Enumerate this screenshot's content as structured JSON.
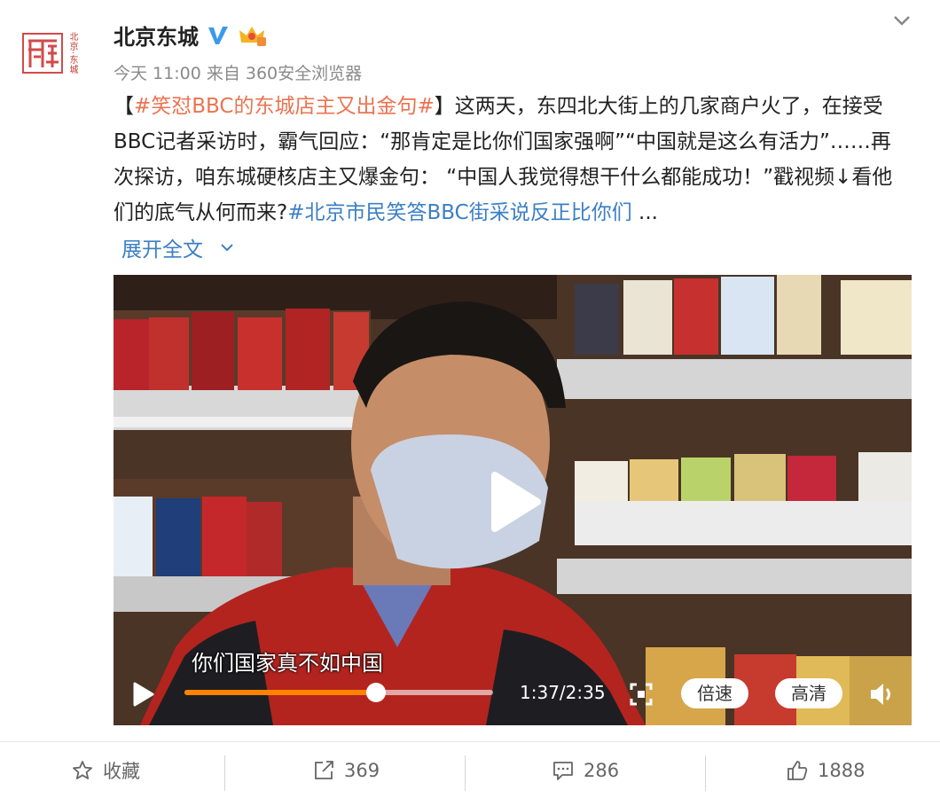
{
  "account": {
    "name": "北京东城",
    "seal_text": "北京·东城"
  },
  "meta": {
    "time": "今天 11:00",
    "source": "来自 360安全浏览器"
  },
  "post": {
    "bracket_open": "【",
    "tag": "#笑怼BBC的东城店主又出金句#",
    "bracket_close": "】",
    "body": "这两天，东四北大街上的几家商户火了，在接受BBC记者采访时，霸气回应：“那肯定是比你们国家强啊”“中国就是这么有活力”……再次探访，咱东城硬核店主又爆金句： “中国人我觉得想干什么都能成功！”戳视频↓看他们的底气从何而来?",
    "topic": "#北京市民笑答BBC街采说反正比你们",
    "ellipsis": " ...",
    "expand_label": "展开全文"
  },
  "video": {
    "subtitle": "你们国家真不如中国",
    "time": "1:37/2:35",
    "progress": 0.62,
    "speed_label": "倍速",
    "quality_label": "高清"
  },
  "actions": {
    "favorite": "收藏",
    "repost": "369",
    "comment": "286",
    "like": "1888"
  },
  "colors": {
    "link": "#3b7fc4",
    "tag": "#eb7350",
    "progress": "#ff8200"
  }
}
